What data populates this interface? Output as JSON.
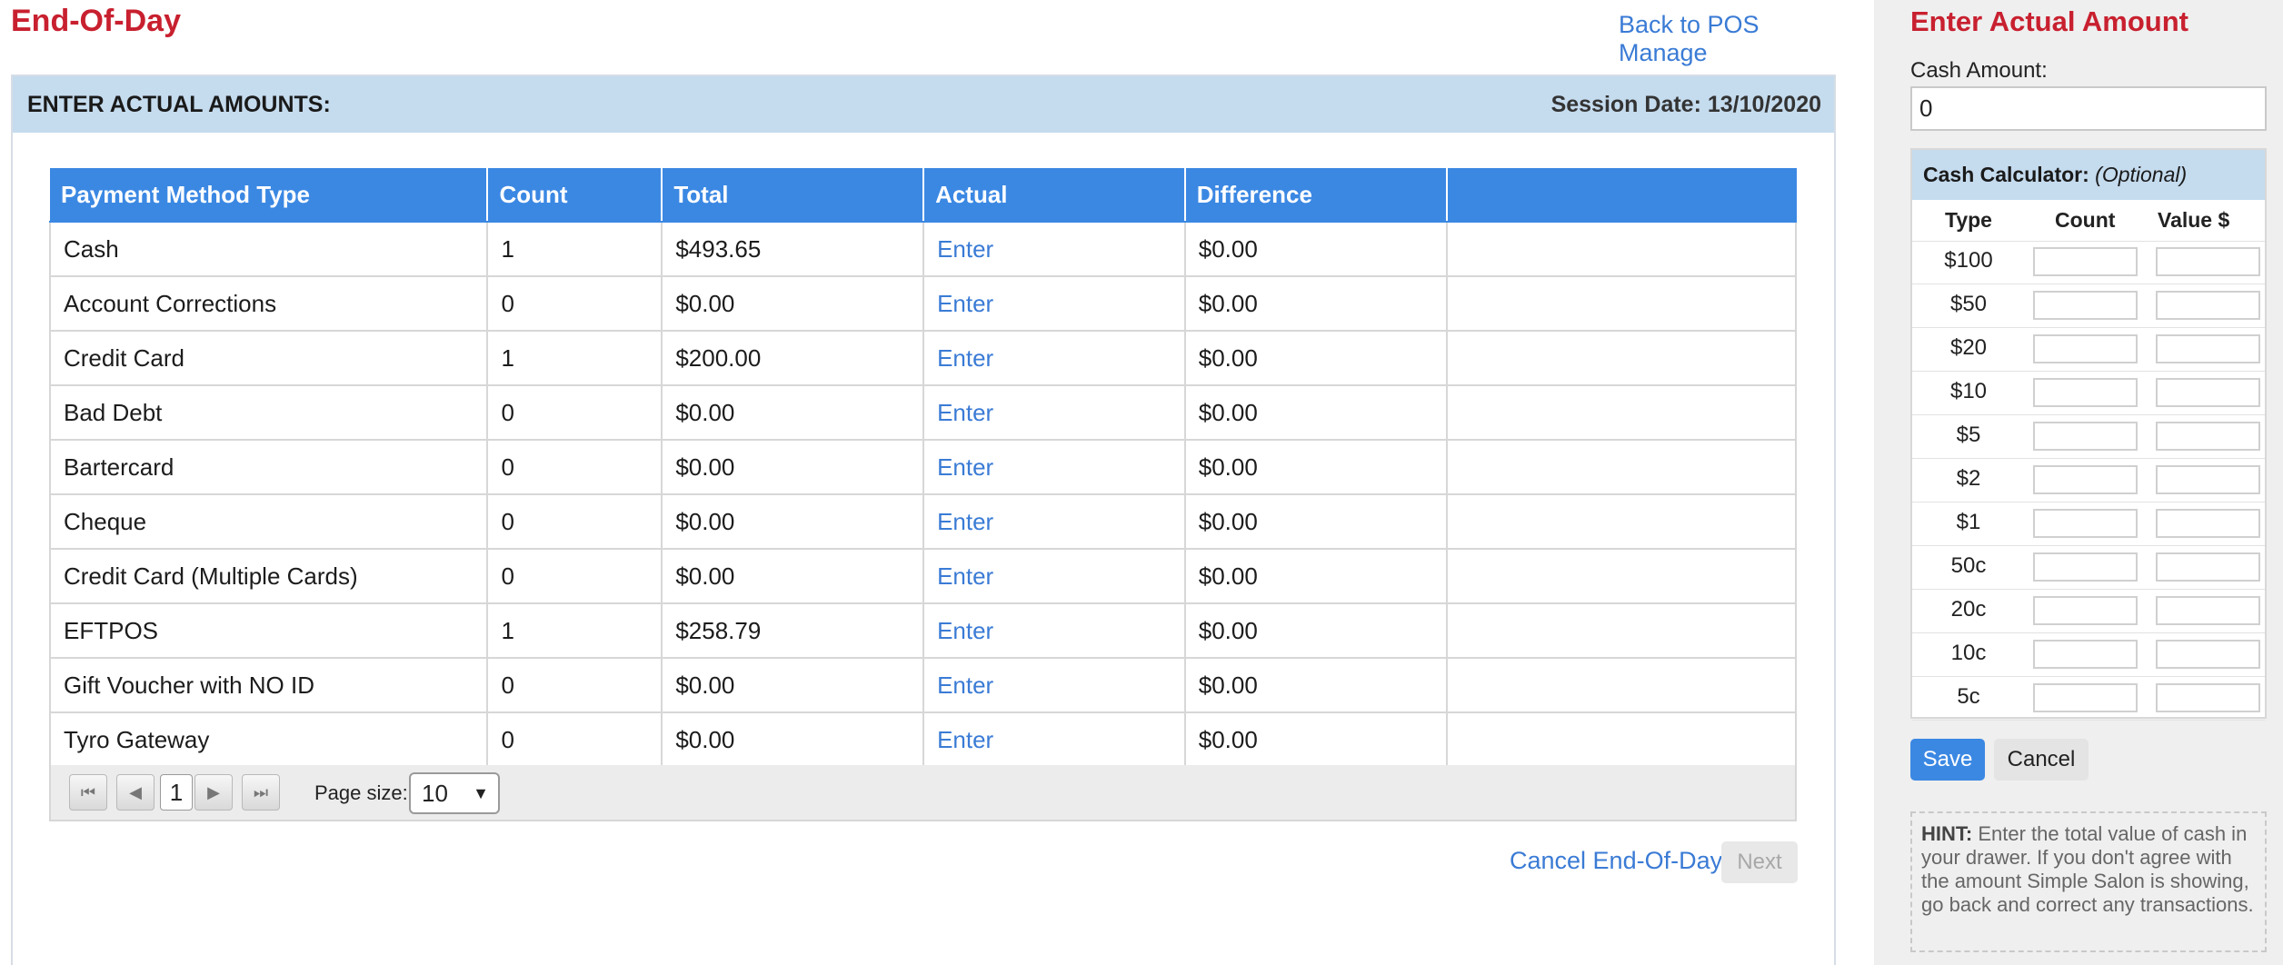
{
  "header": {
    "title": "End-Of-Day",
    "back_link": "Back to POS Manage"
  },
  "panel": {
    "heading": "ENTER ACTUAL AMOUNTS:",
    "session_label": "Session Date:",
    "session_date": "13/10/2020"
  },
  "table": {
    "columns": [
      "Payment Method Type",
      "Count",
      "Total",
      "Actual",
      "Difference",
      ""
    ],
    "rows": [
      {
        "type": "Cash",
        "count": "1",
        "total": "$493.65",
        "actual": "Enter",
        "difference": "$0.00"
      },
      {
        "type": "Account Corrections",
        "count": "0",
        "total": "$0.00",
        "actual": "Enter",
        "difference": "$0.00"
      },
      {
        "type": "Credit Card",
        "count": "1",
        "total": "$200.00",
        "actual": "Enter",
        "difference": "$0.00"
      },
      {
        "type": "Bad Debt",
        "count": "0",
        "total": "$0.00",
        "actual": "Enter",
        "difference": "$0.00"
      },
      {
        "type": "Bartercard",
        "count": "0",
        "total": "$0.00",
        "actual": "Enter",
        "difference": "$0.00"
      },
      {
        "type": "Cheque",
        "count": "0",
        "total": "$0.00",
        "actual": "Enter",
        "difference": "$0.00"
      },
      {
        "type": "Credit Card (Multiple Cards)",
        "count": "0",
        "total": "$0.00",
        "actual": "Enter",
        "difference": "$0.00"
      },
      {
        "type": "EFTPOS",
        "count": "1",
        "total": "$258.79",
        "actual": "Enter",
        "difference": "$0.00"
      },
      {
        "type": "Gift Voucher with NO ID",
        "count": "0",
        "total": "$0.00",
        "actual": "Enter",
        "difference": "$0.00"
      },
      {
        "type": "Tyro Gateway",
        "count": "0",
        "total": "$0.00",
        "actual": "Enter",
        "difference": "$0.00"
      }
    ]
  },
  "pager": {
    "current_page": "1",
    "page_size_label": "Page size:",
    "page_size": "10",
    "icons": [
      "first-page-icon",
      "prev-page-icon",
      "next-page-icon",
      "last-page-icon"
    ]
  },
  "footer_actions": {
    "cancel_label": "Cancel End-Of-Day",
    "next_label": "Next"
  },
  "sidebar": {
    "title": "Enter Actual Amount",
    "cash_amount_label": "Cash Amount:",
    "cash_amount_value": "0",
    "calculator": {
      "title": "Cash Calculator:",
      "optional": "(Optional)",
      "col_type": "Type",
      "col_count": "Count",
      "col_value": "Value $",
      "denominations": [
        "$100",
        "$50",
        "$20",
        "$10",
        "$5",
        "$2",
        "$1",
        "50c",
        "20c",
        "10c",
        "5c"
      ]
    },
    "save_label": "Save",
    "cancel_label": "Cancel",
    "hint_label": "HINT:",
    "hint_text": "Enter the total value of cash in your drawer. If you don't agree with the amount Simple Salon is showing, go back and correct any transactions."
  },
  "colors": {
    "title_red": "#c8202f",
    "link_blue": "#3a7bd5",
    "header_blue": "#3b88e3",
    "panel_head_bg": "#c5dbee",
    "sidebar_bg": "#efefef"
  }
}
